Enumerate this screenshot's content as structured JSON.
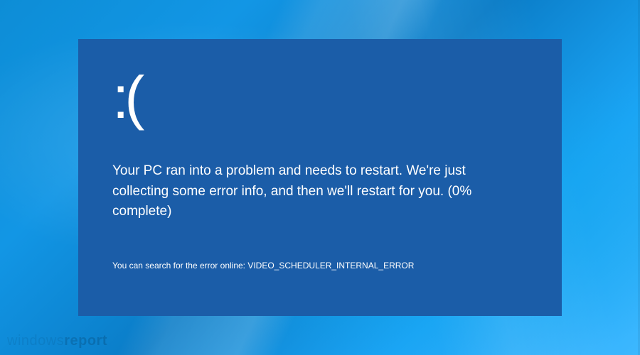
{
  "bsod": {
    "sad_face": ":(",
    "message": "Your PC ran into a problem and needs to restart. We're just collecting some error info, and then we'll restart for  you. (0% complete)",
    "search_prefix": "You can search for the error online: ",
    "error_code": "VIDEO_SCHEDULER_INTERNAL_ERROR"
  },
  "watermark": {
    "part1": "windows",
    "part2": "report"
  },
  "colors": {
    "bsod_bg": "#1b5da8",
    "text": "#ffffff"
  }
}
